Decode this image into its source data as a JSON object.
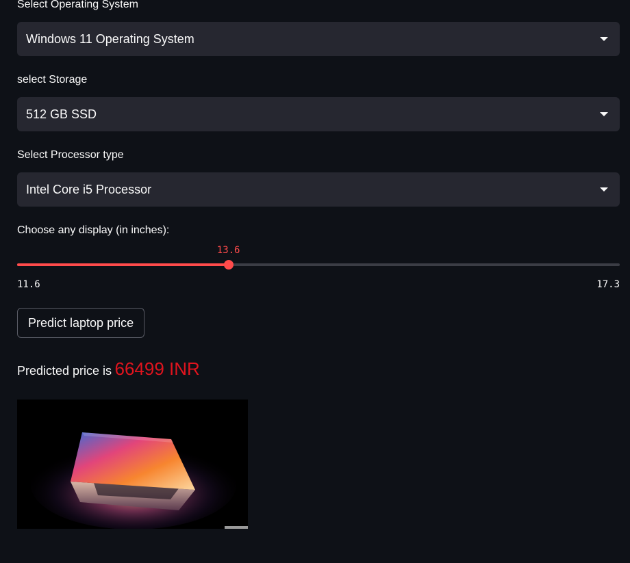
{
  "fields": {
    "os": {
      "label": "Select Operating System",
      "value": "Windows 11 Operating System"
    },
    "storage": {
      "label": "select Storage",
      "value": "512 GB SSD"
    },
    "processor": {
      "label": "Select Processor type",
      "value": "Intel Core i5 Processor"
    }
  },
  "display_slider": {
    "label": "Choose any display (in inches):",
    "value": "13.6",
    "min": "11.6",
    "max": "17.3",
    "value_num": 13.6,
    "min_num": 11.6,
    "max_num": 17.3
  },
  "predict_button": {
    "label": "Predict laptop price"
  },
  "result": {
    "prefix": "Predicted price is",
    "value": "66499 INR"
  },
  "colors": {
    "background": "#0e1117",
    "select_bg": "#262730",
    "accent": "#ff4b4b",
    "price": "#e0141e"
  },
  "image": {
    "subject": "laptop-photo"
  }
}
